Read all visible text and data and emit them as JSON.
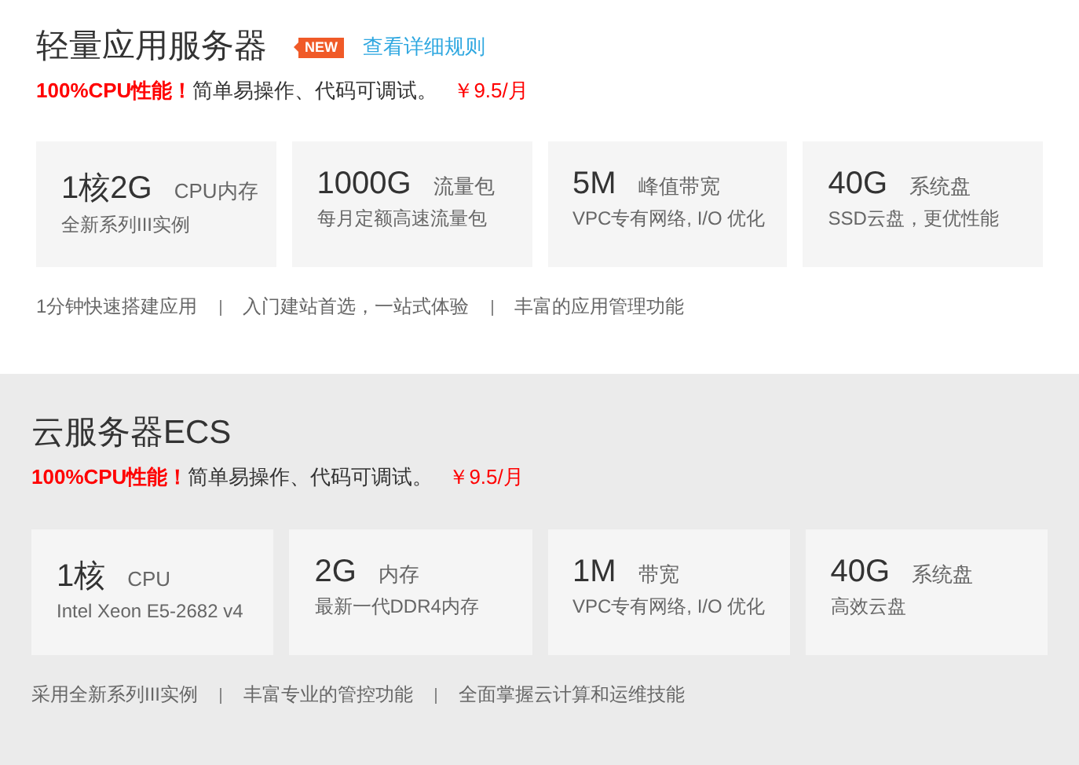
{
  "sections": [
    {
      "title": "轻量应用服务器",
      "badge": "NEW",
      "link": "查看详细规则",
      "tagline": {
        "highlight": "100%CPU性能！",
        "description": "简单易操作、代码可调试。",
        "price": "￥9.5/月"
      },
      "shaded": false,
      "specs": [
        {
          "value": "1核2G",
          "unit": "CPU内存",
          "detail": "全新系列III实例"
        },
        {
          "value": "1000G",
          "unit": "流量包",
          "detail": "每月定额高速流量包"
        },
        {
          "value": "5M",
          "unit": "峰值带宽",
          "detail": "VPC专有网络, I/O 优化"
        },
        {
          "value": "40G",
          "unit": "系统盘",
          "detail": "SSD云盘，更优性能"
        }
      ],
      "features": [
        "1分钟快速搭建应用",
        "入门建站首选，一站式体验",
        "丰富的应用管理功能"
      ]
    },
    {
      "title": "云服务器ECS",
      "tagline": {
        "highlight": "100%CPU性能！",
        "description": "简单易操作、代码可调试。",
        "price": "￥9.5/月"
      },
      "shaded": true,
      "specs": [
        {
          "value": "1核",
          "unit": "CPU",
          "detail": "Intel Xeon E5-2682 v4"
        },
        {
          "value": "2G",
          "unit": "内存",
          "detail": "最新一代DDR4内存"
        },
        {
          "value": "1M",
          "unit": "带宽",
          "detail": "VPC专有网络, I/O 优化"
        },
        {
          "value": "40G",
          "unit": "系统盘",
          "detail": "高效云盘"
        }
      ],
      "features": [
        "采用全新系列III实例",
        "丰富专业的管控功能",
        "全面掌握云计算和运维技能"
      ]
    }
  ]
}
